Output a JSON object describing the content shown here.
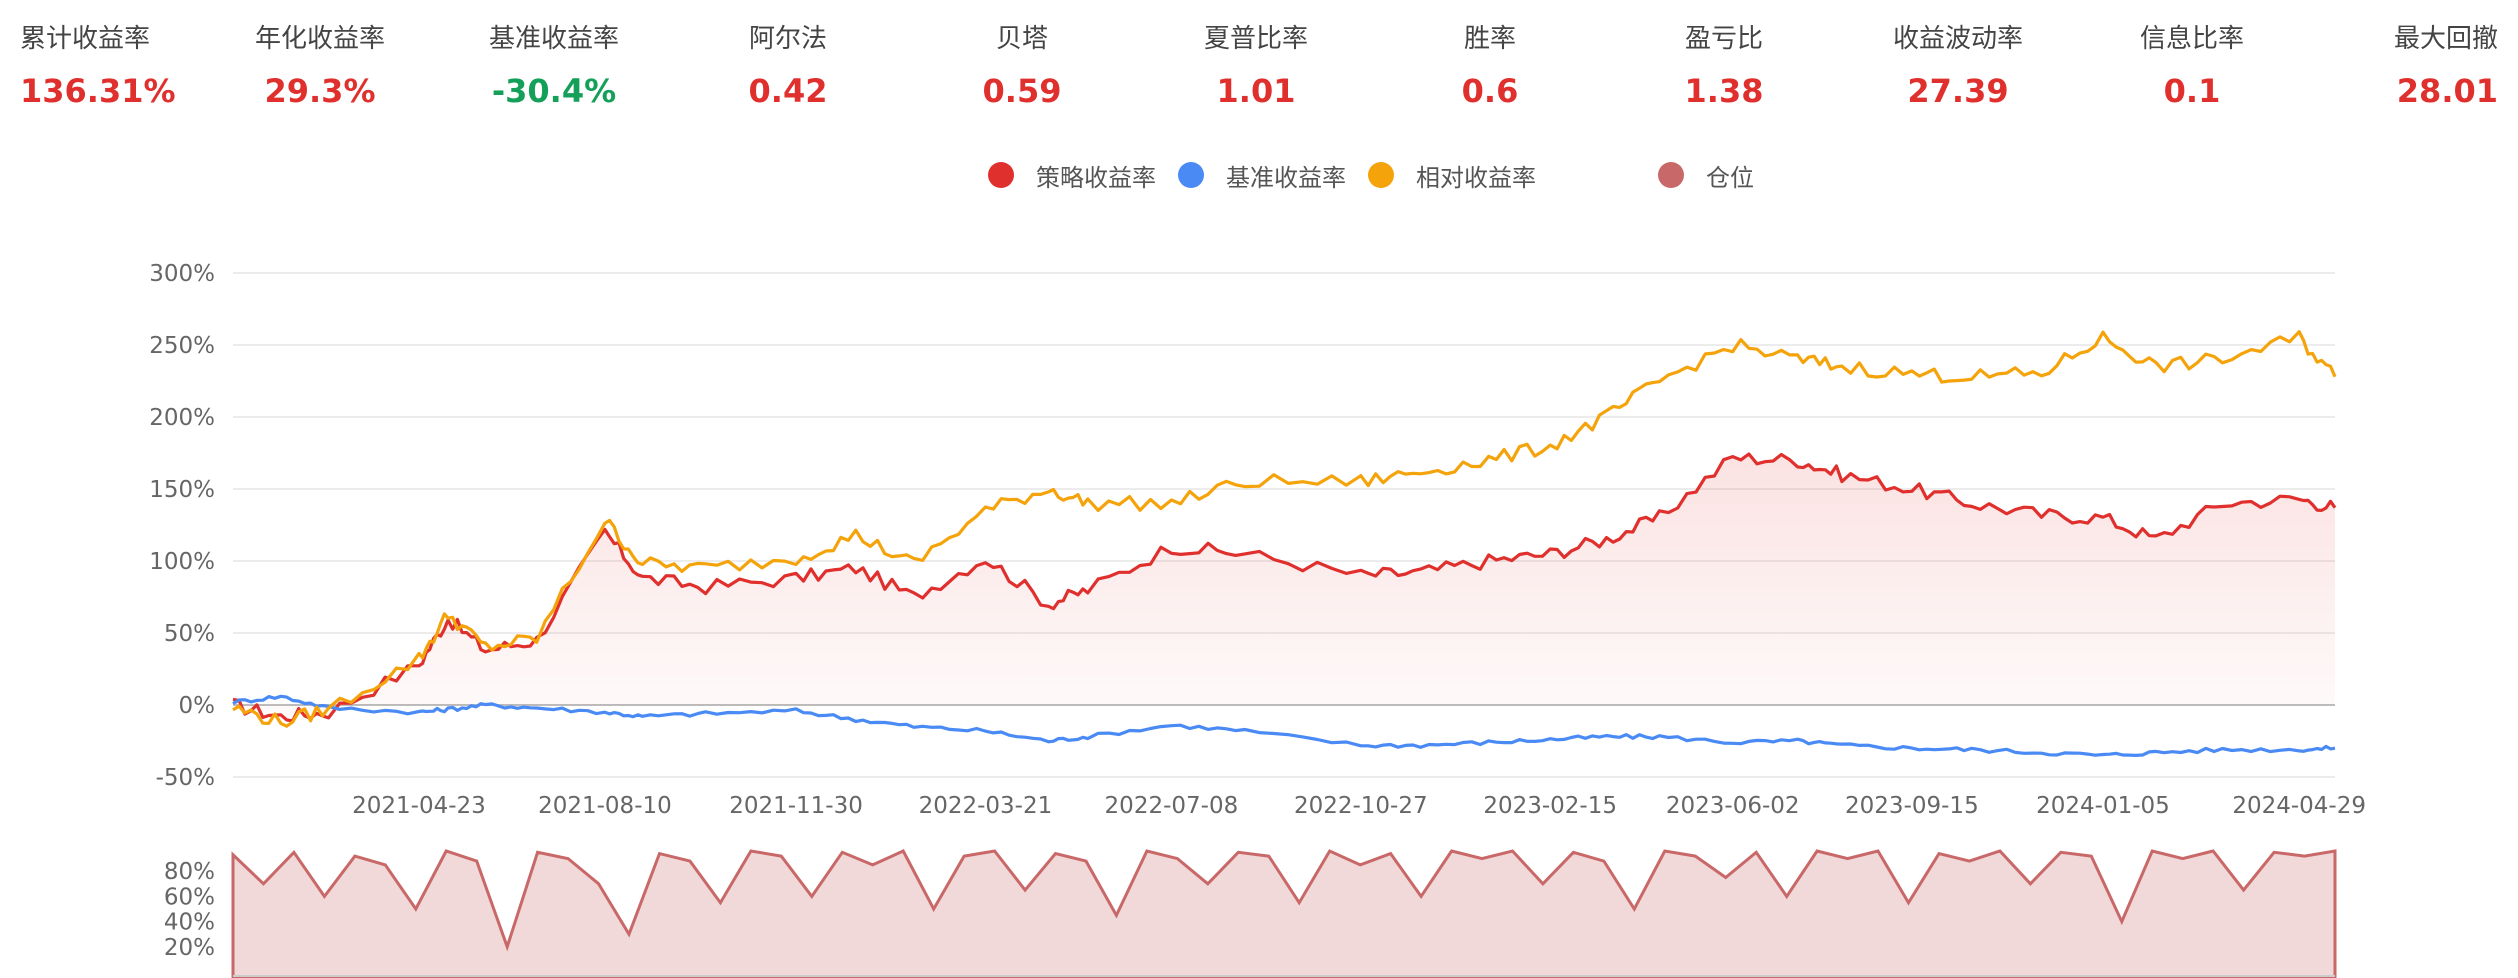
{
  "metrics": [
    {
      "label": "累计收益率",
      "value": "136.31%",
      "color": "#e0302e"
    },
    {
      "label": "年化收益率",
      "value": "29.3%",
      "color": "#e0302e"
    },
    {
      "label": "基准收益率",
      "value": "-30.4%",
      "color": "#15a05a"
    },
    {
      "label": "阿尔法",
      "value": "0.42",
      "color": "#e0302e"
    },
    {
      "label": "贝塔",
      "value": "0.59",
      "color": "#e0302e"
    },
    {
      "label": "夏普比率",
      "value": "1.01",
      "color": "#e0302e"
    },
    {
      "label": "胜率",
      "value": "0.6",
      "color": "#e0302e"
    },
    {
      "label": "盈亏比",
      "value": "1.38",
      "color": "#e0302e"
    },
    {
      "label": "收益波动率",
      "value": "27.39",
      "color": "#e0302e"
    },
    {
      "label": "信息比率",
      "value": "0.1",
      "color": "#e0302e"
    },
    {
      "label": "最大回撤",
      "value": "28.01",
      "color": "#e0302e"
    }
  ],
  "legend": [
    {
      "label": "策略收益率",
      "color": "#e0302e",
      "icon": "circle"
    },
    {
      "label": "基准收益率",
      "color": "#4a8af4",
      "icon": "circle"
    },
    {
      "label": "相对收益率",
      "color": "#f5a30a",
      "icon": "circle"
    },
    {
      "label": "仓位",
      "color": "#c96868",
      "icon": "circle"
    }
  ],
  "chart_data": [
    {
      "type": "line",
      "title": "",
      "xlabel": "",
      "ylabel": "",
      "x_ticks": [
        "2021-04-23",
        "2021-08-10",
        "2021-11-30",
        "2022-03-21",
        "2022-07-08",
        "2022-10-27",
        "2023-02-15",
        "2023-06-02",
        "2023-09-15",
        "2024-01-05",
        "2024-04-29"
      ],
      "y_ticks": [
        "300%",
        "250%",
        "200%",
        "150%",
        "100%",
        "50%",
        "0%",
        "-50%"
      ],
      "ylim": [
        -50,
        300
      ],
      "grid": true,
      "legend_position": "top-center",
      "x": [
        "2021-01-04",
        "2021-02-01",
        "2021-03-01",
        "2021-04-23",
        "2021-05-10",
        "2021-06-01",
        "2021-07-01",
        "2021-08-10",
        "2021-09-01",
        "2021-10-08",
        "2021-11-30",
        "2022-01-04",
        "2022-02-07",
        "2022-03-21",
        "2022-04-27",
        "2022-05-20",
        "2022-07-08",
        "2022-08-20",
        "2022-10-27",
        "2022-12-01",
        "2023-01-10",
        "2023-02-15",
        "2023-03-20",
        "2023-04-20",
        "2023-06-02",
        "2023-07-10",
        "2023-08-05",
        "2023-09-15",
        "2023-10-20",
        "2023-11-30",
        "2024-01-05",
        "2024-02-05",
        "2024-03-15",
        "2024-04-29",
        "2024-05-20"
      ],
      "series": [
        {
          "name": "策略收益率",
          "color": "#e0302e",
          "fill": true,
          "values": [
            0,
            -8,
            -5,
            28,
            60,
            38,
            45,
            120,
            88,
            82,
            88,
            95,
            75,
            102,
            70,
            80,
            110,
            105,
            90,
            92,
            100,
            105,
            115,
            130,
            172,
            170,
            160,
            150,
            140,
            132,
            130,
            115,
            140,
            143,
            137
          ]
        },
        {
          "name": "基准收益率",
          "color": "#4a8af4",
          "fill": false,
          "values": [
            2,
            6,
            -2,
            -5,
            -3,
            0,
            -2,
            -5,
            -8,
            -6,
            -4,
            -10,
            -15,
            -18,
            -25,
            -22,
            -14,
            -18,
            -28,
            -28,
            -26,
            -24,
            -22,
            -22,
            -26,
            -25,
            -28,
            -30,
            -31,
            -33,
            -35,
            -33,
            -31,
            -31,
            -30
          ]
        },
        {
          "name": "相对收益率",
          "color": "#f5a30a",
          "fill": false,
          "values": [
            -2,
            -12,
            -3,
            32,
            63,
            40,
            46,
            128,
            98,
            95,
            102,
            118,
            98,
            135,
            150,
            140,
            140,
            155,
            155,
            162,
            170,
            180,
            200,
            225,
            250,
            240,
            235,
            230,
            228,
            230,
            255,
            235,
            240,
            255,
            228
          ]
        }
      ]
    },
    {
      "type": "area",
      "title": "",
      "y_ticks": [
        "80%",
        "60%",
        "40%",
        "20%"
      ],
      "ylim": [
        0,
        100
      ],
      "series": [
        {
          "name": "仓位",
          "color": "#c96868",
          "values": [
            93,
            70,
            95,
            60,
            92,
            85,
            50,
            96,
            88,
            20,
            95,
            90,
            70,
            30,
            94,
            88,
            55,
            96,
            92,
            60,
            95,
            85,
            96,
            50,
            92,
            96,
            65,
            94,
            88,
            45,
            96,
            90,
            70,
            95,
            92,
            55,
            96,
            85,
            94,
            60,
            96,
            90,
            96,
            70,
            95,
            88,
            50,
            96,
            92,
            75,
            95,
            60,
            96,
            90,
            96,
            55,
            94,
            88,
            96,
            70,
            95,
            92,
            40,
            96,
            90,
            96,
            65,
            95,
            92,
            96
          ]
        }
      ]
    }
  ]
}
